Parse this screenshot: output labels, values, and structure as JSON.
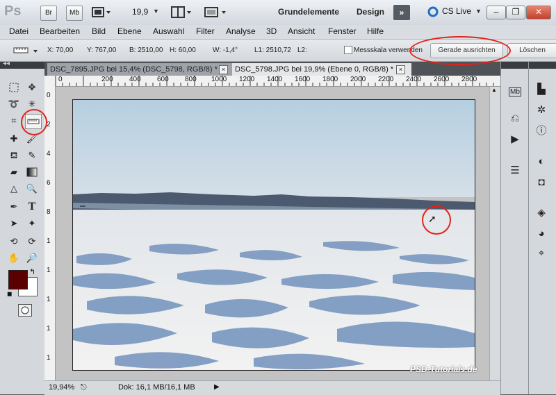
{
  "app": {
    "logo": "Ps",
    "bridge": "Br",
    "mini_bridge": "Mb",
    "zoom": "19,9",
    "workspaces": [
      "Grundelemente",
      "Design"
    ],
    "more": "»",
    "cs_live": "CS Live"
  },
  "menu": [
    "Datei",
    "Bearbeiten",
    "Bild",
    "Ebene",
    "Auswahl",
    "Filter",
    "Analyse",
    "3D",
    "Ansicht",
    "Fenster",
    "Hilfe"
  ],
  "options": {
    "x": "X: 70,00",
    "y": "Y: 767,00",
    "b": "B: 2510,00",
    "h": "H: 60,00",
    "w": "W: -1,4°",
    "l1": "L1: 2510,72",
    "l2": "L2:",
    "measure_scale": "Messskala verwenden",
    "straighten": "Gerade ausrichten",
    "clear": "Löschen"
  },
  "tabs": [
    {
      "label": "DSC_7895.JPG bei 15,4% (DSC_5798, RGB/8) *",
      "close": "×"
    },
    {
      "label": "DSC_5798.JPG bei 19,9% (Ebene 0, RGB/8) *",
      "close": "×"
    }
  ],
  "ruler_top": [
    "0",
    "200",
    "400",
    "600",
    "800",
    "1000",
    "1200",
    "1400",
    "1600",
    "1800",
    "2000",
    "2200",
    "2400",
    "2600",
    "2800"
  ],
  "ruler_left": [
    "0",
    "2",
    "4",
    "6",
    "8",
    "1",
    "1",
    "1",
    "1",
    "1",
    "1"
  ],
  "status": {
    "zoom": "19,94%",
    "doc": "Dok: 16,1 MB/16,1 MB"
  },
  "watermark": "PSD-Tutorials.de",
  "colors": {
    "foreground": "#5a0000",
    "background": "#ffffff",
    "annotation": "#e0231b"
  }
}
